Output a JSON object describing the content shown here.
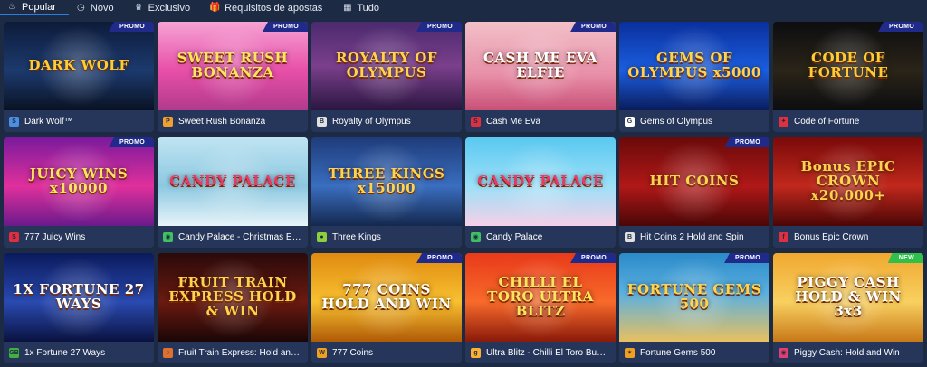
{
  "tabs": [
    {
      "label": "Popular",
      "icon": "fire-icon",
      "glyph": "♨"
    },
    {
      "label": "Novo",
      "icon": "clock-icon",
      "glyph": "◷"
    },
    {
      "label": "Exclusivo",
      "icon": "crown-icon",
      "glyph": "♛"
    },
    {
      "label": "Requisitos de apostas",
      "icon": "gift-icon",
      "glyph": "🎁"
    },
    {
      "label": "Tudo",
      "icon": "grid-icon",
      "glyph": "▦"
    }
  ],
  "games": [
    {
      "name": "Dark Wolf™",
      "art": "DARK WOLF",
      "badge": "PROMO",
      "bg": "linear-gradient(180deg,#0d1b3a 0%,#1c3a6e 55%,#0a1224 100%)",
      "accent": "#ffcc33",
      "provider_icon": "softswiss-icon",
      "provider_color": "#4a90e2",
      "provider_glyph": "S"
    },
    {
      "name": "Sweet Rush Bonanza",
      "art": "SWEET RUSH BONANZA",
      "badge": "PROMO",
      "bg": "linear-gradient(180deg,#f5a3d4 0%,#e84fa8 55%,#b13a8c 100%)",
      "accent": "#ffe45c",
      "provider_icon": "pragmatic-icon",
      "provider_color": "#f0a030",
      "provider_glyph": "P"
    },
    {
      "name": "Royalty of Olympus",
      "art": "ROYALTY OF OLYMPUS",
      "badge": "PROMO",
      "bg": "linear-gradient(180deg,#4a2a6e 0%,#7b3f8c 50%,#2a1640 100%)",
      "accent": "#ffd34d",
      "provider_icon": "bbb-icon",
      "provider_color": "#e0e0e0",
      "provider_glyph": "B"
    },
    {
      "name": "Cash Me Eva",
      "art": "CASH ME EVA ELFIE",
      "badge": "PROMO",
      "bg": "linear-gradient(180deg,#f2c0c8 0%,#e88fa8 60%,#c85078 100%)",
      "accent": "#ffffff",
      "provider_icon": "spinomenal-icon",
      "provider_color": "#e03040",
      "provider_glyph": "S"
    },
    {
      "name": "Gems of Olympus",
      "art": "GEMS OF OLYMPUS x5000",
      "badge": "",
      "bg": "linear-gradient(180deg,#0a2f9c 0%,#1b5ee0 55%,#0a1c5c 100%)",
      "accent": "#ffd34d",
      "provider_icon": "gamzix-icon",
      "provider_color": "#ffffff",
      "provider_glyph": "G"
    },
    {
      "name": "Code of Fortune",
      "art": "CODE OF FORTUNE",
      "badge": "PROMO",
      "bg": "linear-gradient(180deg,#0d0d10 0%,#2a2418 55%,#0d0d10 100%)",
      "accent": "#ffcc33",
      "provider_icon": "playtech-icon",
      "provider_color": "#e03040",
      "provider_glyph": "✦"
    },
    {
      "name": "777 Juicy Wins",
      "art": "JUICY WINS x10000",
      "badge": "PROMO",
      "bg": "linear-gradient(180deg,#7a1a9c 0%,#e0309c 55%,#6a1a8c 100%)",
      "accent": "#ffe45c",
      "provider_icon": "spinomenal-icon",
      "provider_color": "#e03040",
      "provider_glyph": "S"
    },
    {
      "name": "Candy Palace - Christmas Edition",
      "art": "CANDY PALACE",
      "badge": "",
      "bg": "linear-gradient(180deg,#bfe4f2 0%,#8cc8e0 55%,#e8f4fa 100%)",
      "accent": "#e83a6a",
      "provider_icon": "playson-icon",
      "provider_color": "#40c060",
      "provider_glyph": "◉"
    },
    {
      "name": "Three Kings",
      "art": "THREE KINGS x15000",
      "badge": "",
      "bg": "linear-gradient(180deg,#1e3c7a 0%,#3a6ec0 55%,#14284e 100%)",
      "accent": "#ffd34d",
      "provider_icon": "relax-icon",
      "provider_color": "#8cd040",
      "provider_glyph": "●"
    },
    {
      "name": "Candy Palace",
      "art": "CANDY PALACE",
      "badge": "",
      "bg": "linear-gradient(180deg,#5ac8f0 0%,#9ce0f8 55%,#f6d0e8 100%)",
      "accent": "#e83a6a",
      "provider_icon": "playson-icon",
      "provider_color": "#40c060",
      "provider_glyph": "◉"
    },
    {
      "name": "Hit Coins 2 Hold and Spin",
      "art": "HIT COINS",
      "badge": "PROMO",
      "bg": "linear-gradient(180deg,#6a0a0a 0%,#b01818 55%,#4a0606 100%)",
      "accent": "#ffd34d",
      "provider_icon": "bbb-icon",
      "provider_color": "#e0e0e0",
      "provider_glyph": "B"
    },
    {
      "name": "Bonus Epic Crown",
      "art": "Bonus EPIC CROWN x20.000+",
      "badge": "",
      "bg": "linear-gradient(180deg,#7a0a0a 0%,#c0281c 55%,#4a0606 100%)",
      "accent": "#ffd34d",
      "provider_icon": "fazi-icon",
      "provider_color": "#e03040",
      "provider_glyph": "f"
    },
    {
      "name": "1x Fortune 27 Ways",
      "art": "1X FORTUNE 27 WAYS",
      "badge": "",
      "bg": "linear-gradient(180deg,#0a1a5c 0%,#2a4ab0 55%,#0a1240 100%)",
      "accent": "#ffffff",
      "provider_icon": "gb-icon",
      "provider_color": "#40b040",
      "provider_glyph": "GB"
    },
    {
      "name": "Fruit Train Express: Hold and Win",
      "art": "FRUIT TRAIN EXPRESS HOLD & WIN",
      "badge": "",
      "bg": "linear-gradient(180deg,#2a0a0a 0%,#6a1a10 55%,#1a0606 100%)",
      "accent": "#ffd34d",
      "provider_icon": "circle-provider-icon",
      "provider_color": "#e07030",
      "provider_glyph": "○"
    },
    {
      "name": "777 Coins",
      "art": "777 COINS HOLD AND WIN",
      "badge": "PROMO",
      "bg": "linear-gradient(180deg,#e08a10 0%,#f8c030 55%,#b05a06 100%)",
      "accent": "#ffffff",
      "provider_icon": "wazdan-icon",
      "provider_color": "#f0a020",
      "provider_glyph": "W"
    },
    {
      "name": "Ultra Blitz - Chilli El Toro Buy Bonus",
      "art": "CHILLI EL TORO ULTRA BLITZ",
      "badge": "PROMO",
      "bg": "linear-gradient(180deg,#e83a1a 0%,#f86a2a 55%,#8a1a0a 100%)",
      "accent": "#ffe45c",
      "provider_icon": "gamomat-icon",
      "provider_color": "#ffb030",
      "provider_glyph": "g"
    },
    {
      "name": "Fortune Gems 500",
      "art": "FORTUNE GEMS 500",
      "badge": "PROMO",
      "bg": "linear-gradient(180deg,#2a8ac8 0%,#5ab0e0 45%,#e8c060 100%)",
      "accent": "#ffd34d",
      "provider_icon": "jili-icon",
      "provider_color": "#f0a020",
      "provider_glyph": "✶"
    },
    {
      "name": "Piggy Cash: Hold and Win",
      "art": "PIGGY CASH HOLD & WIN 3x3",
      "badge": "NEW",
      "bg": "linear-gradient(180deg,#f0a830 0%,#f8d060 55%,#c87818 100%)",
      "accent": "#ffffff",
      "provider_icon": "bgaming-icon",
      "provider_color": "#e04070",
      "provider_glyph": "◉"
    }
  ]
}
